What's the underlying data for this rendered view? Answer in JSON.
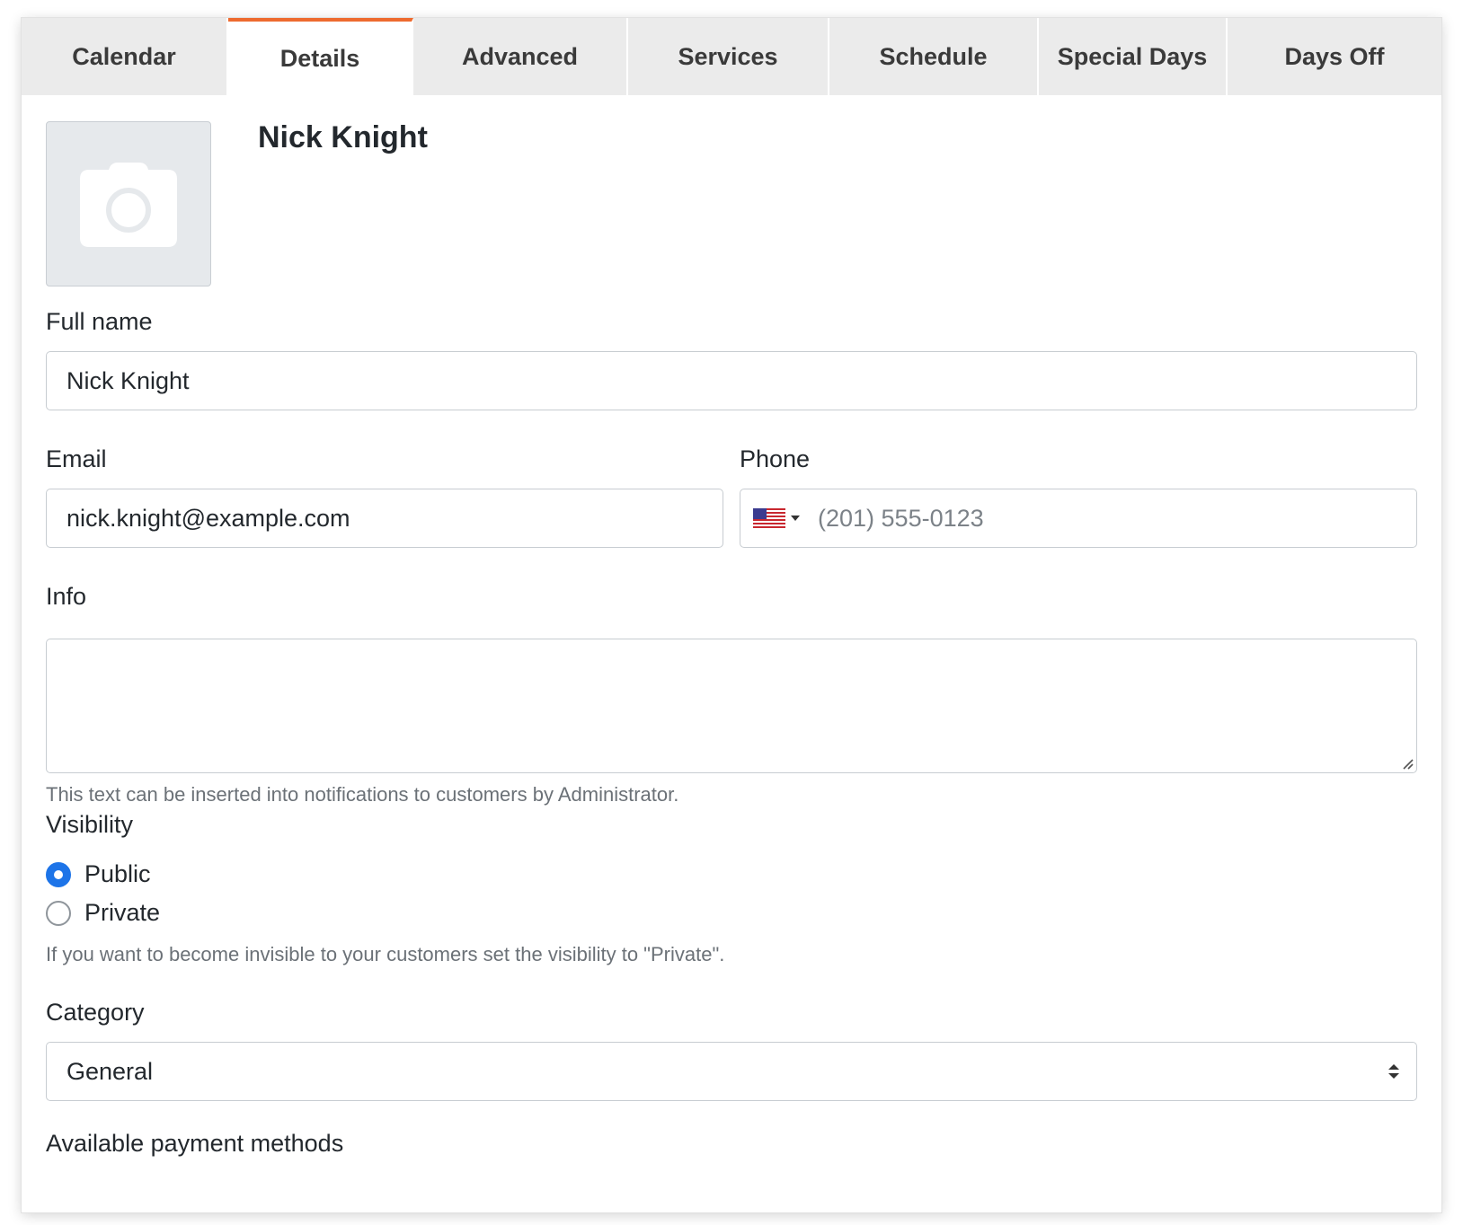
{
  "tabs": [
    {
      "label": "Calendar",
      "active": false
    },
    {
      "label": "Details",
      "active": true
    },
    {
      "label": "Advanced",
      "active": false
    },
    {
      "label": "Services",
      "active": false
    },
    {
      "label": "Schedule",
      "active": false
    },
    {
      "label": "Special Days",
      "active": false
    },
    {
      "label": "Days Off",
      "active": false
    }
  ],
  "colors": {
    "accent_tab": "#ee6a2e",
    "radio_checked": "#1d74e8"
  },
  "staff": {
    "name": "Nick Knight",
    "avatar_icon": "camera-icon"
  },
  "form": {
    "full_name": {
      "label": "Full name",
      "value": "Nick Knight"
    },
    "email": {
      "label": "Email",
      "value": "nick.knight@example.com"
    },
    "phone": {
      "label": "Phone",
      "placeholder": "(201) 555-0123",
      "flag_icon": "us-flag-icon"
    },
    "info": {
      "label": "Info",
      "value": "",
      "hint": "This text can be inserted into notifications to customers by Administrator."
    },
    "visibility": {
      "label": "Visibility",
      "options": [
        {
          "label": "Public",
          "checked": true
        },
        {
          "label": "Private",
          "checked": false
        }
      ],
      "hint": "If you want to become invisible to your customers set the visibility to \"Private\"."
    },
    "category": {
      "label": "Category",
      "selected": "General"
    },
    "payment_methods": {
      "label": "Available payment methods"
    }
  }
}
